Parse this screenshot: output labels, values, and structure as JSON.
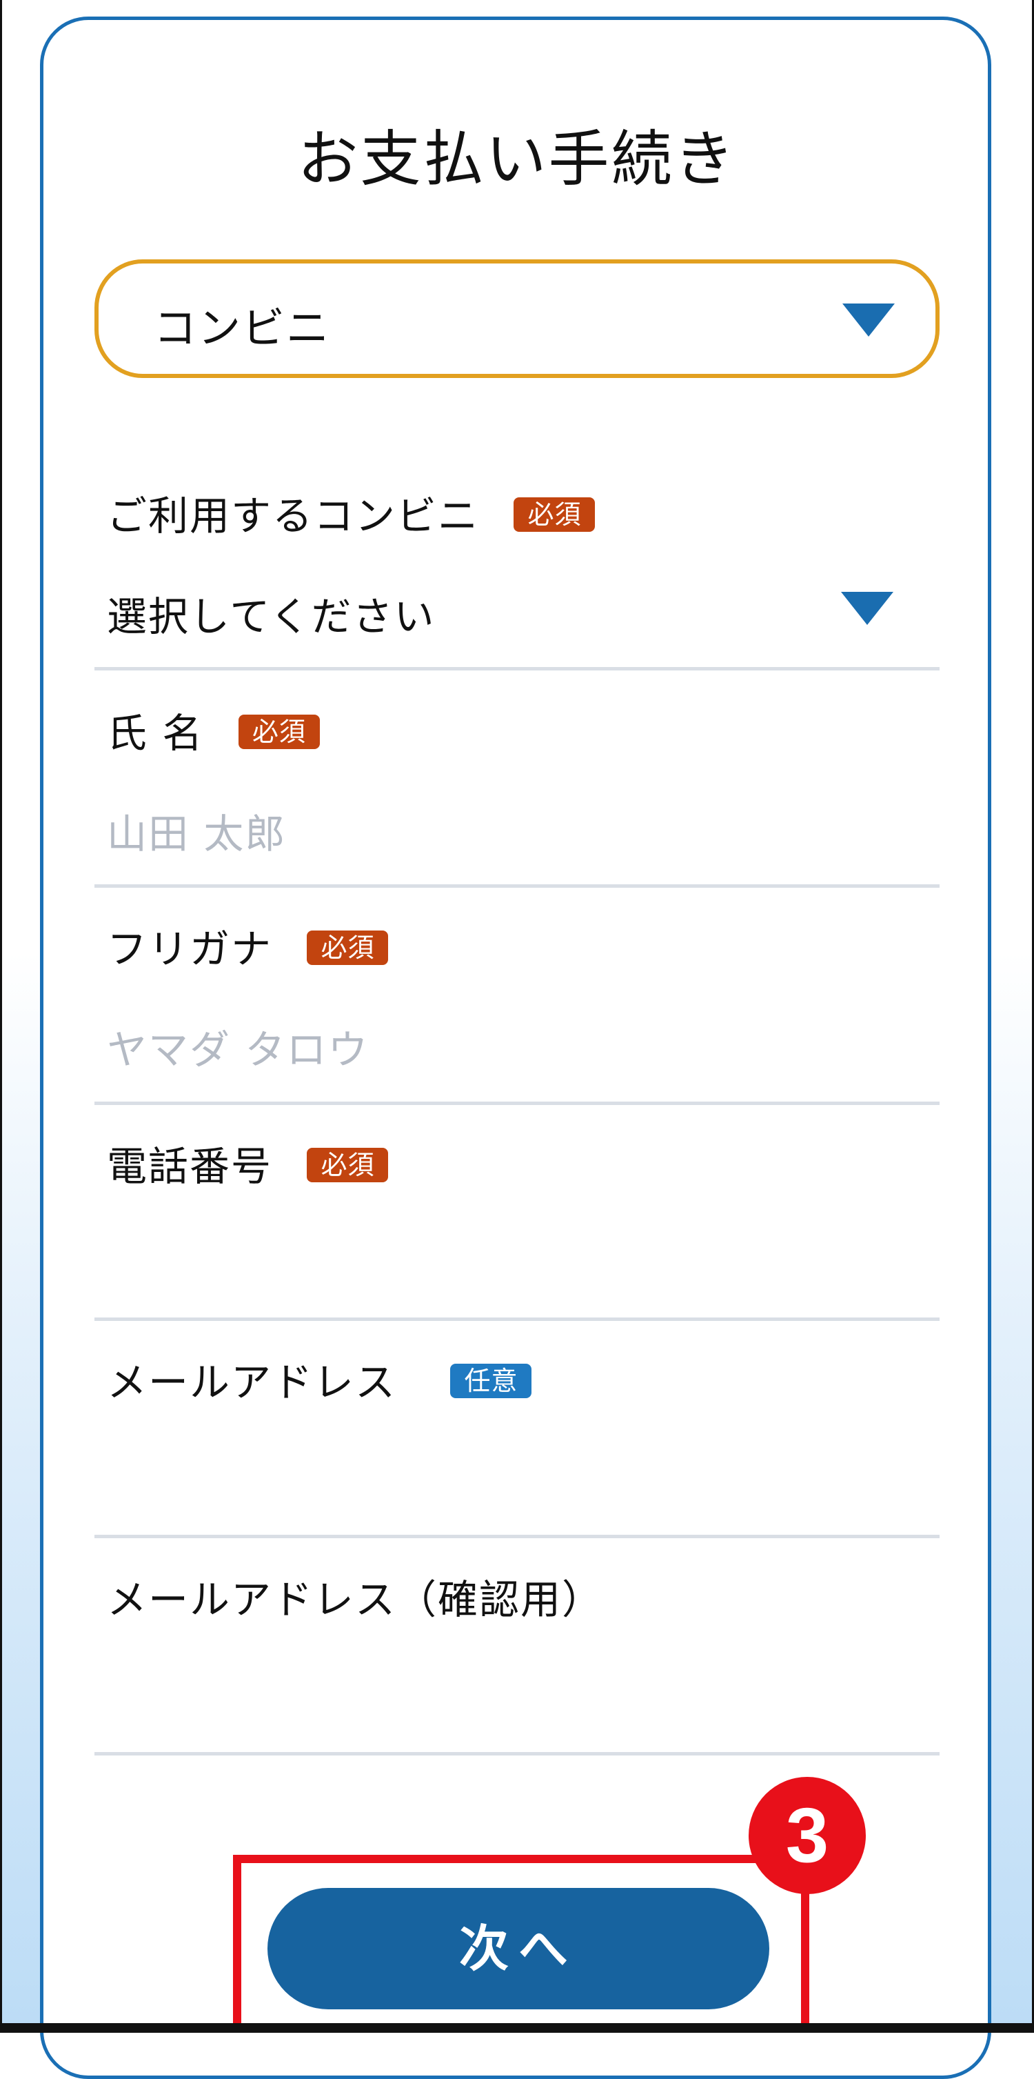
{
  "page": {
    "title": "お支払い手続き"
  },
  "payment_method": {
    "value": "コンビニ",
    "icon": "dropdown-triangle-icon"
  },
  "form": {
    "convenience_store": {
      "label": "ご利用するコンビニ",
      "badge": "必須",
      "value": "選択してください"
    },
    "name": {
      "label": "氏 名",
      "badge": "必須",
      "placeholder": "山田 太郎"
    },
    "furigana": {
      "label": "フリガナ",
      "badge": "必須",
      "placeholder": "ヤマダ タロウ"
    },
    "phone": {
      "label": "電話番号",
      "badge": "必須",
      "value": ""
    },
    "email": {
      "label": "メールアドレス",
      "badge": "任意",
      "value": ""
    },
    "email_confirm": {
      "label": "メールアドレス（確認用）",
      "value": ""
    }
  },
  "next_button": {
    "label": "次へ"
  },
  "annotation": {
    "step_number": "3"
  },
  "colors": {
    "card_border": "#1a6fb5",
    "select_border": "#e2a020",
    "required_badge": "#c2440f",
    "optional_badge": "#1f7ac2",
    "button": "#17639f",
    "highlight": "#e8101a",
    "placeholder": "#b4bac4"
  }
}
